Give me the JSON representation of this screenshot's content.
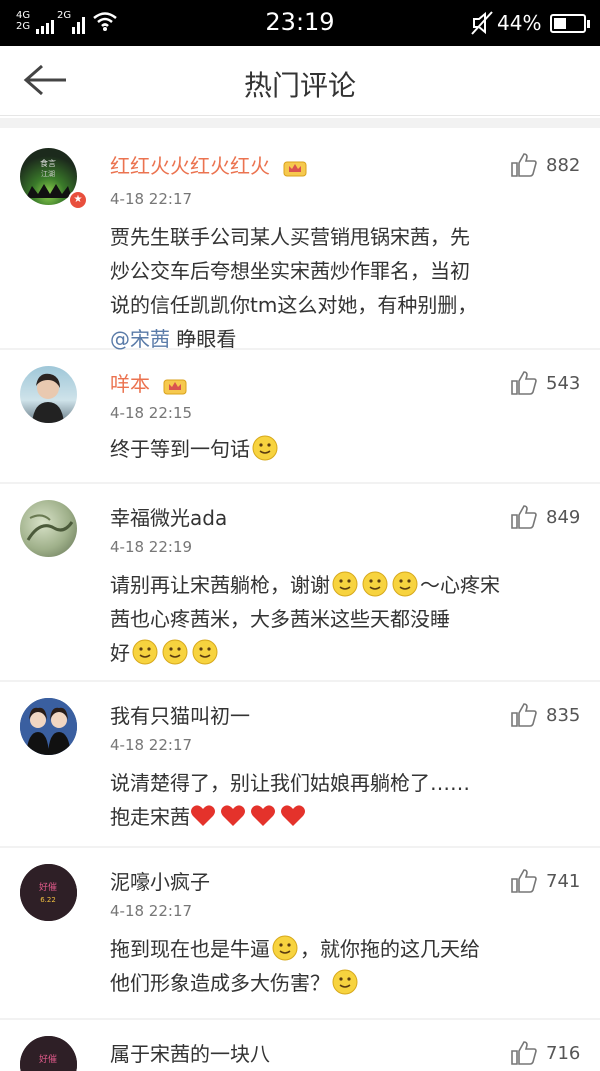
{
  "status_bar": {
    "network_top": "4G",
    "network_bottom": "2G",
    "network2": "2G",
    "time": "23:19",
    "battery": "44%",
    "battery_level": 0.44
  },
  "header": {
    "title": "热门评论"
  },
  "comments": [
    {
      "name": "红红火火红火红火",
      "time": "4-18 22:17",
      "likes": "882",
      "text_lines": [
        "贾先生联手公司某人买营销甩锅宋茜，先",
        "炒公交车后夸想坐实宋茜炒作罪名，当初",
        "说的信任凯凯你tm这么对她，有种别删，"
      ],
      "mention": "@宋茜",
      "text_after_mention": " 睁眼看"
    },
    {
      "name": "咩本",
      "time": "4-18 22:15",
      "likes": "543",
      "text_lines": [
        "终于等到一句话"
      ]
    },
    {
      "name": "幸福微光ada",
      "time": "4-18 22:19",
      "likes": "849",
      "text_lines": [
        "请别再让宋茜躺枪，谢谢",
        "～心疼宋",
        "茜也心疼茜米，大多茜米这些天都没睡",
        "好"
      ]
    },
    {
      "name": "我有只猫叫初一",
      "time": "4-18 22:17",
      "likes": "835",
      "text_lines": [
        "说清楚得了，别让我们姑娘再躺枪了……",
        "抱走宋茜"
      ]
    },
    {
      "name": "泥嚎小疯子",
      "time": "4-18 22:17",
      "likes": "741",
      "text_lines": [
        "拖到现在也是牛逼",
        "，就你拖的这几天给",
        "他们形象造成多大伤害？"
      ]
    },
    {
      "name": "属于宋茜的一块八",
      "likes": "716"
    }
  ],
  "colors": {
    "username_vip": "#eb7350",
    "mention": "#5a7ba8",
    "vip_badge": "#e84f3d"
  }
}
